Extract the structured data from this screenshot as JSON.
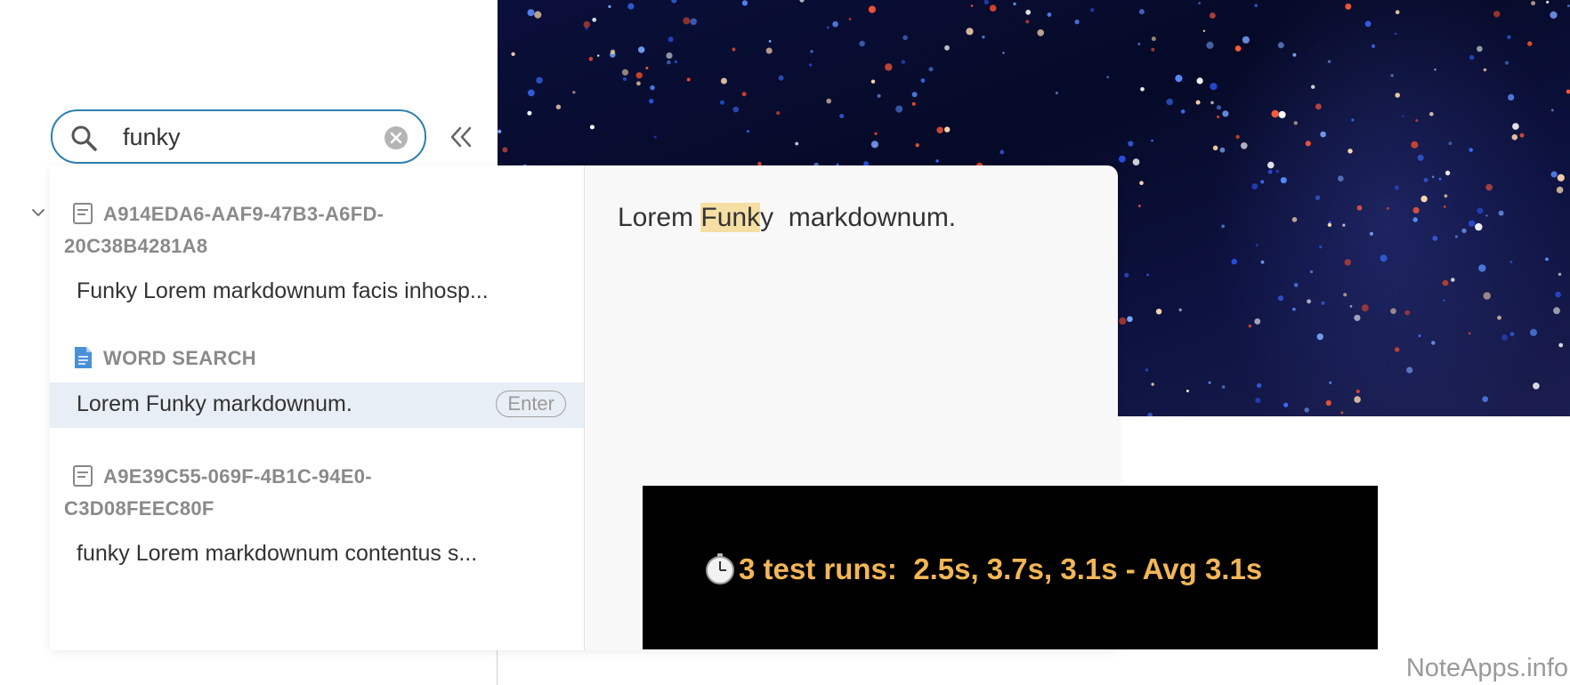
{
  "search": {
    "value": "funky"
  },
  "results": {
    "groups": [
      {
        "title_line1": "A914EDA6-AAF9-47B3-A6FD-",
        "title_line2": "20C38B4281A8",
        "icon": "document-outline-icon",
        "item": "Funky Lorem markdownum facis inhosp..."
      },
      {
        "title_line1": "WORD SEARCH",
        "icon": "blue-document-icon",
        "item": "Lorem Funky markdownum.",
        "badge": "Enter"
      },
      {
        "title_line1": "A9E39C55-069F-4B1C-94E0-",
        "title_line2": "C3D08FEEC80F",
        "icon": "document-outline-icon",
        "item": "funky Lorem markdownum contentus s..."
      }
    ]
  },
  "preview": {
    "pre": "Lorem ",
    "highlight": "Funk",
    "post": "y  markdownum."
  },
  "overlay": {
    "text": "3 test runs:  2.5s, 3.7s, 3.1s - Avg 3.1s",
    "icon": "stopwatch-icon"
  },
  "watermark": "NoteApps.info",
  "colors": {
    "search_border": "#2d7fb0",
    "highlight": "#f6dfa5",
    "selected_row": "#e8eef5",
    "overlay_text": "#f2b656"
  }
}
